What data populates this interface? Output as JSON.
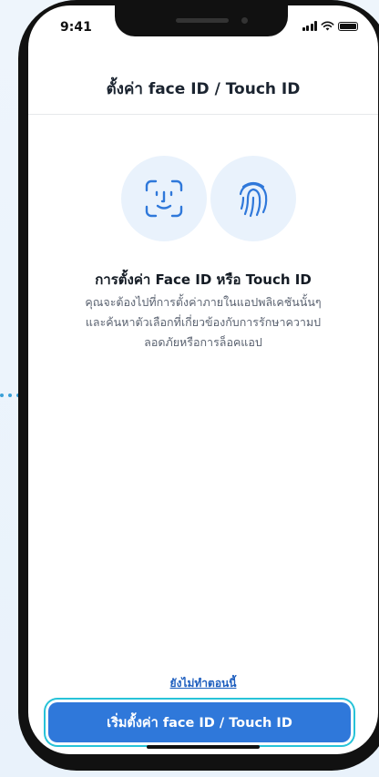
{
  "status_bar": {
    "time": "9:41"
  },
  "header": {
    "title": "ตั้งค่า face ID / Touch ID"
  },
  "icons": {
    "face": "face-id-icon",
    "fingerprint": "fingerprint-icon"
  },
  "content": {
    "title": "การตั้งค่า Face ID หรือ Touch ID",
    "description_lines": [
      "คุณจะต้องไปที่การตั้งค่าภายในแอปพลิเคชันนั้นๆ",
      "และค้นหาตัวเลือกที่เกี่ยวข้องกับการรักษาความป",
      "ลอดภัยหรือการล็อคแอป"
    ]
  },
  "actions": {
    "skip_label": "ยังไม่ทำตอนนี้",
    "primary_label": "เริ่มตั้งค่า face ID / Touch ID"
  },
  "colors": {
    "accent": "#2f78da",
    "focus_ring": "#27c3d8",
    "icon_bg": "#e9f2fc",
    "icon_stroke": "#2f78da"
  }
}
